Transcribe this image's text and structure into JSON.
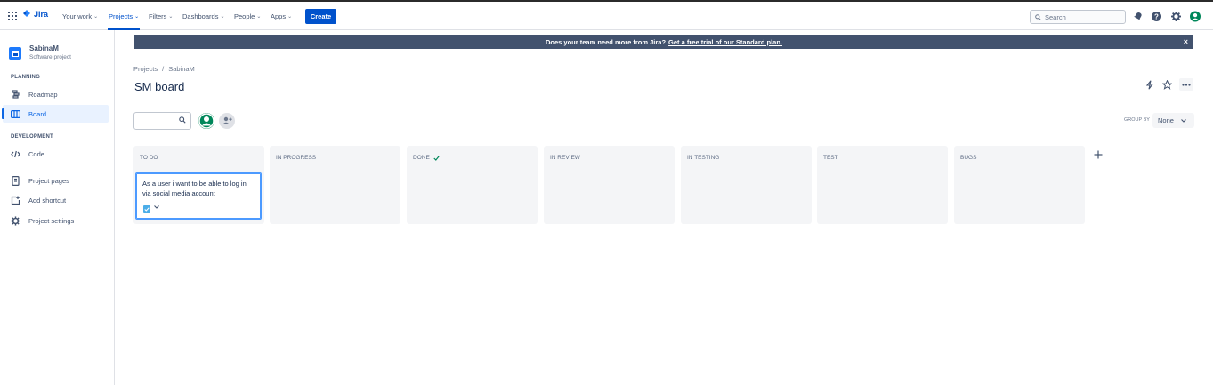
{
  "topnav": {
    "logo": "Jira",
    "items": [
      {
        "label": "Your work"
      },
      {
        "label": "Projects"
      },
      {
        "label": "Filters"
      },
      {
        "label": "Dashboards"
      },
      {
        "label": "People"
      },
      {
        "label": "Apps"
      }
    ],
    "create_label": "Create",
    "search_placeholder": "Search"
  },
  "sidebar": {
    "project_name": "SabinaM",
    "project_type": "Software project",
    "planning_title": "PLANNING",
    "development_title": "DEVELOPMENT",
    "items": [
      {
        "label": "Roadmap",
        "icon": "roadmap-icon"
      },
      {
        "label": "Board",
        "icon": "board-icon"
      },
      {
        "label": "Code",
        "icon": "code-icon"
      },
      {
        "label": "Project pages",
        "icon": "page-icon"
      },
      {
        "label": "Add shortcut",
        "icon": "add-shortcut-icon"
      },
      {
        "label": "Project settings",
        "icon": "gear-icon"
      }
    ]
  },
  "banner": {
    "text": "Does your team need more from Jira?",
    "link": "Get a free trial of our Standard plan."
  },
  "breadcrumb": {
    "root": "Projects",
    "sep": "/",
    "project": "SabinaM"
  },
  "page_title": "SM board",
  "toolbar": {
    "group_by_label": "GROUP BY",
    "group_by_value": "None"
  },
  "columns": [
    {
      "title": "TO DO"
    },
    {
      "title": "IN PROGRESS"
    },
    {
      "title": "DONE"
    },
    {
      "title": "IN REVIEW"
    },
    {
      "title": "IN TESTING"
    },
    {
      "title": "TEST"
    },
    {
      "title": "BUGS"
    }
  ],
  "card": {
    "text": "As a user i want to be able to log in via social media account"
  },
  "colors": {
    "brand": "#0052cc",
    "banner_bg": "#42526e",
    "column_bg": "#f4f5f7",
    "card_border": "#4c9aff",
    "done_check": "#00875a"
  }
}
